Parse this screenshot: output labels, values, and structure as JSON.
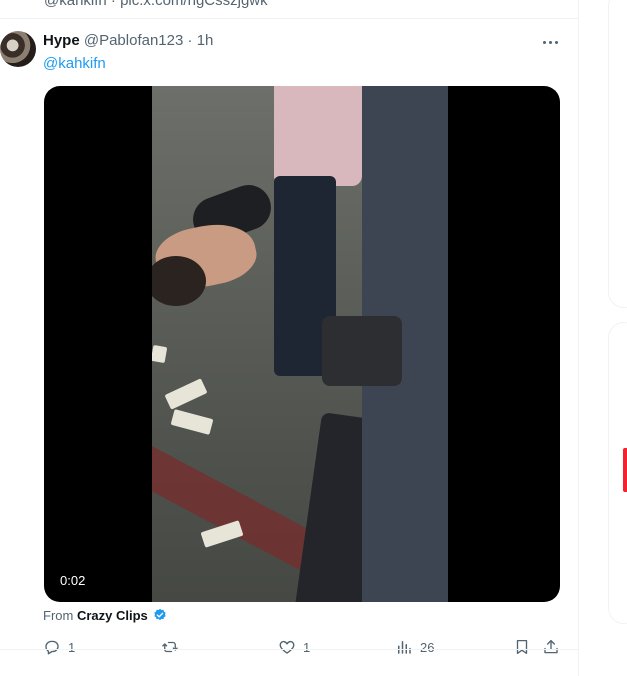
{
  "previous_tweet": {
    "link_text": "@kahkifn · pic.x.com/ngCsszjgwk"
  },
  "tweet": {
    "author": {
      "name": "Hype",
      "handle": "@Pablofan123",
      "separator": "·",
      "time": "1h"
    },
    "mention": "@kahkifn",
    "media": {
      "type": "video",
      "duration": "0:02"
    },
    "source": {
      "prefix": "From",
      "name": "Crazy Clips",
      "verified": true
    },
    "actions": {
      "reply_count": "1",
      "retweet_count": "",
      "like_count": "1",
      "view_count": "26"
    }
  },
  "icons": [
    "more-icon",
    "play-video",
    "verified-badge-icon",
    "reply-icon",
    "retweet-icon",
    "like-icon",
    "views-icon",
    "bookmark-icon",
    "share-icon"
  ],
  "colors": {
    "accent": "#1d9bf0",
    "text_secondary": "#536471",
    "border": "#eff3f4",
    "alert": "#f4212e"
  }
}
